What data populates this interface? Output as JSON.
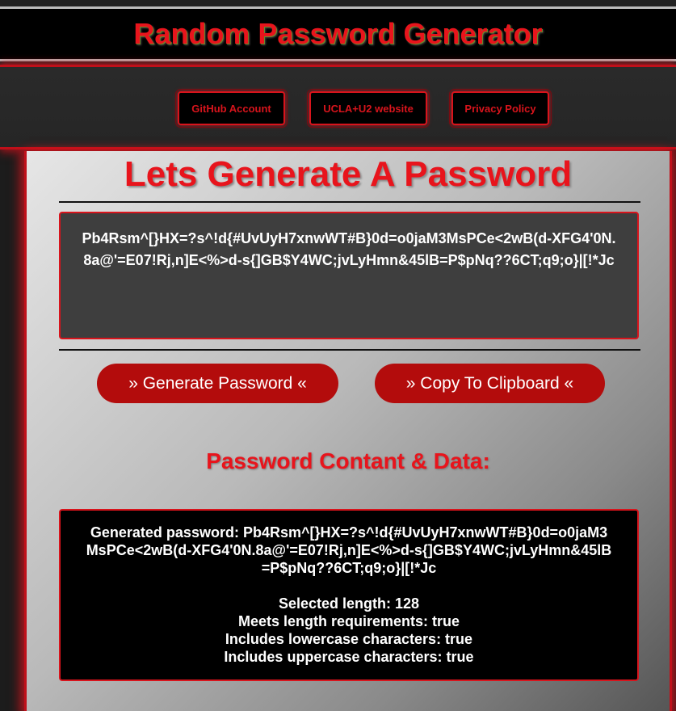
{
  "header": {
    "title": "Random Password Generator"
  },
  "nav": {
    "items": [
      {
        "label": "GitHub Account"
      },
      {
        "label": "UCLA+U2 website"
      },
      {
        "label": "Privacy Policy"
      }
    ]
  },
  "main": {
    "heading": "Lets Generate A Password",
    "password_display": "Pb4Rsm^[}HX=?s^!d{#UvUyH7xnwWT#B}0d=o0jaM3MsPCe<2wB(d-XFG4'0N.8a@'=E07!Rj,n]E<%>d-s{]GB$Y4WC;jvLyHmn&45lB=P$pNq??6CT;q9;o}|[!*Jc",
    "generate_button": "» Generate Password «",
    "copy_button": "» Copy To Clipboard «",
    "data_heading": "Password Contant & Data:",
    "data": {
      "generated_password_line": "Generated password: Pb4Rsm^[}HX=?s^!d{#UvUyH7xnwWT#B}0d=o0jaM3MsPCe<2wB(d-XFG4'0N.8a@'=E07!Rj,n]E<%>d-s{]GB$Y4WC;jvLyHmn&45lB=P$pNq??6CT;q9;o}|[!*Jc",
      "selected_length": "Selected length: 128",
      "meets_length": "Meets length requirements: true",
      "includes_lowercase": "Includes lowercase characters: true",
      "includes_uppercase": "Includes uppercase characters: true"
    }
  },
  "colors": {
    "accent_red": "#e8141c",
    "button_red": "#b30c0c",
    "dark_bg": "#1c1c1c"
  }
}
